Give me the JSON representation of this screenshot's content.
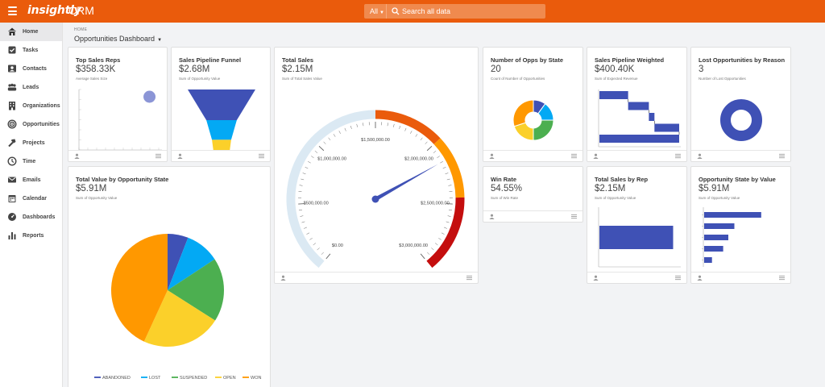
{
  "app": {
    "logo": "insightly",
    "product": "CRM"
  },
  "search": {
    "scope": "All",
    "placeholder": "Search all data"
  },
  "sidebar": {
    "items": [
      {
        "label": "Home",
        "icon": "home-icon",
        "active": true
      },
      {
        "label": "Tasks",
        "icon": "tasks-icon"
      },
      {
        "label": "Contacts",
        "icon": "contacts-icon"
      },
      {
        "label": "Leads",
        "icon": "leads-icon"
      },
      {
        "label": "Organizations",
        "icon": "organizations-icon"
      },
      {
        "label": "Opportunities",
        "icon": "opportunities-icon"
      },
      {
        "label": "Projects",
        "icon": "projects-icon"
      },
      {
        "label": "Time",
        "icon": "time-icon"
      },
      {
        "label": "Emails",
        "icon": "emails-icon"
      },
      {
        "label": "Calendar",
        "icon": "calendar-icon"
      },
      {
        "label": "Dashboards",
        "icon": "dashboards-icon"
      },
      {
        "label": "Reports",
        "icon": "reports-icon"
      }
    ]
  },
  "breadcrumb": "HOME",
  "page_title": "Opportunities Dashboard",
  "colors": {
    "accent": "#ea5b0c",
    "navy": "#3f51b5",
    "sky": "#03a9f4",
    "green": "#4caf50",
    "yellow": "#fbd02a",
    "orange": "#ff9800",
    "red": "#c40e0e"
  },
  "cards": {
    "top_sales_reps": {
      "title": "Top Sales Reps",
      "value": "$358.33K",
      "subtitle": "Average Sales Size"
    },
    "pipeline_funnel": {
      "title": "Sales Pipeline Funnel",
      "value": "$2.68M",
      "subtitle": "Sum of Opportunity Value"
    },
    "total_sales": {
      "title": "Total Sales",
      "value": "$2.15M",
      "subtitle": "Sum of Total Sales Value"
    },
    "opps_by_state": {
      "title": "Number of Opps by State",
      "value": "20",
      "subtitle": "Count of Number of Opportunities"
    },
    "pipeline_weighted": {
      "title": "Sales Pipeline Weighted",
      "value": "$400.40K",
      "subtitle": "Sum of Expected Revenue"
    },
    "lost_by_reason": {
      "title": "Lost Opportunities by Reason",
      "value": "3",
      "subtitle": "Number of Lost Opportunities"
    },
    "value_by_state": {
      "title": "Total Value by Opportunity State",
      "value": "$5.91M",
      "subtitle": "Sum of Opportunity Value"
    },
    "win_rate": {
      "title": "Win Rate",
      "value": "54.55%",
      "subtitle": "Sum of Win Rate"
    },
    "sales_by_rep": {
      "title": "Total Sales by Rep",
      "value": "$2.15M",
      "subtitle": "Sum of Opportunity Value"
    },
    "state_by_value": {
      "title": "Opportunity State by Value",
      "value": "$5.91M",
      "subtitle": "Sum of Opportunity Value"
    }
  },
  "chart_data": [
    {
      "id": "top_sales_reps",
      "type": "scatter",
      "points": [
        {
          "x": 0.85,
          "y": 0.88
        }
      ],
      "xlim": [
        0,
        1
      ],
      "ylim": [
        0,
        1
      ]
    },
    {
      "id": "pipeline_funnel",
      "type": "bar",
      "categories": [
        "",
        "",
        ""
      ],
      "values": [
        3.0,
        1.35,
        0.85
      ]
    },
    {
      "id": "total_sales",
      "type": "gauge",
      "value": 2150000,
      "min": 0,
      "max": 3000000,
      "tick_labels": [
        "$0.00",
        "$500,000.00",
        "$1,000,000.00",
        "$1,500,000.00",
        "$2,000,000.00",
        "$2,500,000.00",
        "$3,000,000.00"
      ],
      "ranges": [
        {
          "from": 0,
          "to": 1500000,
          "color": "#dbe9f3"
        },
        {
          "from": 1500000,
          "to": 2000000,
          "color": "#ea5b0c"
        },
        {
          "from": 2000000,
          "to": 2450000,
          "color": "#ff9800"
        },
        {
          "from": 2450000,
          "to": 3000000,
          "color": "#c40e0e"
        }
      ]
    },
    {
      "id": "opps_by_state",
      "type": "pie",
      "donut": true,
      "values": [
        2,
        3,
        5,
        4,
        6
      ],
      "colors": [
        "#3f51b5",
        "#03a9f4",
        "#4caf50",
        "#fbd02a",
        "#ff9800"
      ]
    },
    {
      "id": "pipeline_weighted",
      "type": "bar",
      "orientation": "horizontal",
      "waterfall": true,
      "bars": [
        {
          "start": 0,
          "end": 0.36
        },
        {
          "start": 0.36,
          "end": 0.62
        },
        {
          "start": 0.62,
          "end": 0.69
        },
        {
          "start": 0.69,
          "end": 1.0
        },
        {
          "start": 0,
          "end": 1.0
        }
      ]
    },
    {
      "id": "lost_by_reason",
      "type": "pie",
      "donut": true,
      "values": [
        3
      ],
      "colors": [
        "#3f51b5"
      ]
    },
    {
      "id": "value_by_state",
      "type": "pie",
      "categories": [
        "ABANDONED",
        "LOST",
        "SUSPENDED",
        "OPEN",
        "WON"
      ],
      "legend": [
        "ABANDONED",
        "LOST",
        "SUSPENDED",
        "OPEN",
        "WON"
      ],
      "values": [
        0.35,
        0.58,
        1.08,
        1.35,
        2.55
      ],
      "colors": [
        "#3f51b5",
        "#03a9f4",
        "#4caf50",
        "#fbd02a",
        "#ff9800"
      ],
      "legend_position": "bottom"
    },
    {
      "id": "sales_by_rep",
      "type": "bar",
      "orientation": "horizontal",
      "values": [
        2.15
      ],
      "xlim": [
        0,
        2.35
      ]
    },
    {
      "id": "state_by_value",
      "type": "bar",
      "orientation": "horizontal",
      "values": [
        2.55,
        1.35,
        1.08,
        0.85,
        0.35
      ],
      "xlim": [
        0,
        3.6
      ]
    }
  ]
}
